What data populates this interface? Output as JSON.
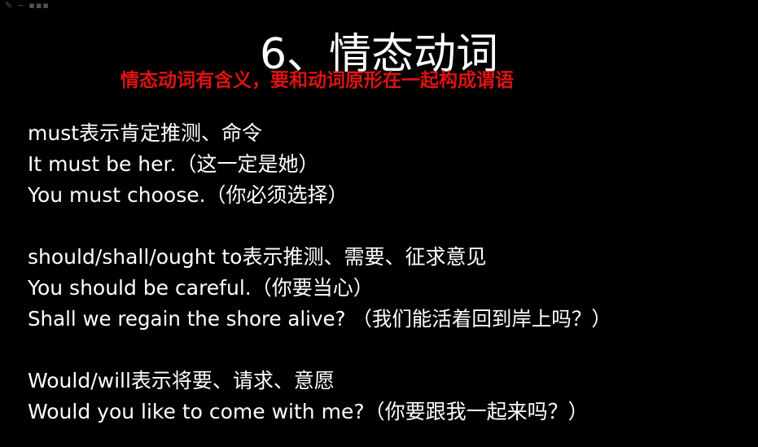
{
  "title": "6、情态动词",
  "subtitle": "情态动词有含义，要和动词原形在一起构成谓语",
  "sections": [
    {
      "lines": [
        "must表示肯定推测、命令",
        "It must be her.（这一定是她）",
        "You must choose.（你必须选择）"
      ]
    },
    {
      "lines": [
        "should/shall/ought to表示推测、需要、征求意见",
        "You should be careful.（你要当心）",
        "Shall we regain the shore alive? （我们能活着回到岸上吗？）"
      ]
    },
    {
      "lines": [
        "Would/will表示将要、请求、意愿",
        "Would you like to come with me?（你要跟我一起来吗？）"
      ]
    }
  ],
  "colors": {
    "background": "#000000",
    "text": "#ffffff",
    "subtitle": "#e01212"
  }
}
